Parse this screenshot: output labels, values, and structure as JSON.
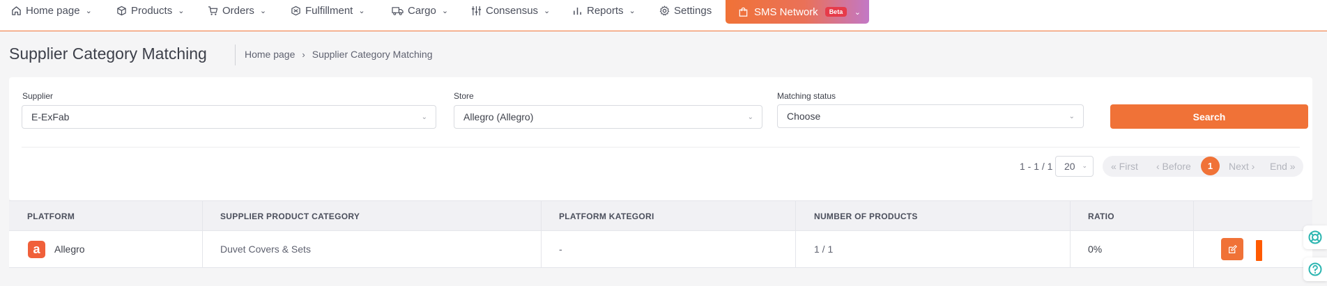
{
  "nav": {
    "items": [
      {
        "label": "Home page",
        "icon": "home-icon",
        "chevron": true
      },
      {
        "label": "Products",
        "icon": "box-icon",
        "chevron": true
      },
      {
        "label": "Orders",
        "icon": "cart-icon",
        "chevron": true
      },
      {
        "label": "Fulfillment",
        "icon": "fulfillment-icon",
        "chevron": true
      },
      {
        "label": "Cargo",
        "icon": "truck-icon",
        "chevron": true
      },
      {
        "label": "Consensus",
        "icon": "sliders-icon",
        "chevron": true
      },
      {
        "label": "Reports",
        "icon": "bar-chart-icon",
        "chevron": true
      },
      {
        "label": "Settings",
        "icon": "gear-icon",
        "chevron": false
      }
    ],
    "sms": {
      "label": "SMS Network",
      "badge": "Beta"
    }
  },
  "header": {
    "title": "Supplier Category Matching",
    "breadcrumb": [
      "Home page",
      "Supplier Category Matching"
    ]
  },
  "filters": {
    "supplier": {
      "label": "Supplier",
      "value": "E-ExFab"
    },
    "store": {
      "label": "Store",
      "value": "Allegro (Allegro)"
    },
    "status": {
      "label": "Matching status",
      "placeholder": "Choose"
    },
    "search_label": "Search"
  },
  "pagination": {
    "info": "1 - 1 / 1",
    "page_size": "20",
    "first": "« First",
    "before": "‹ Before",
    "current": "1",
    "next": "Next ›",
    "end": "End »"
  },
  "table": {
    "headers": [
      "PLATFORM",
      "SUPPLIER PRODUCT CATEGORY",
      "PLATFORM KATEGORI",
      "NUMBER OF PRODUCTS",
      "RATIO"
    ],
    "rows": [
      {
        "platform": "Allegro",
        "logo_letter": "a",
        "supplier_category": "Duvet Covers & Sets",
        "platform_category": "-",
        "num_products": "1 / 1",
        "ratio": "0%"
      }
    ]
  },
  "colors": {
    "accent": "#f07237",
    "beta": "#e63b4a",
    "gradient_end": "#c278c6"
  }
}
